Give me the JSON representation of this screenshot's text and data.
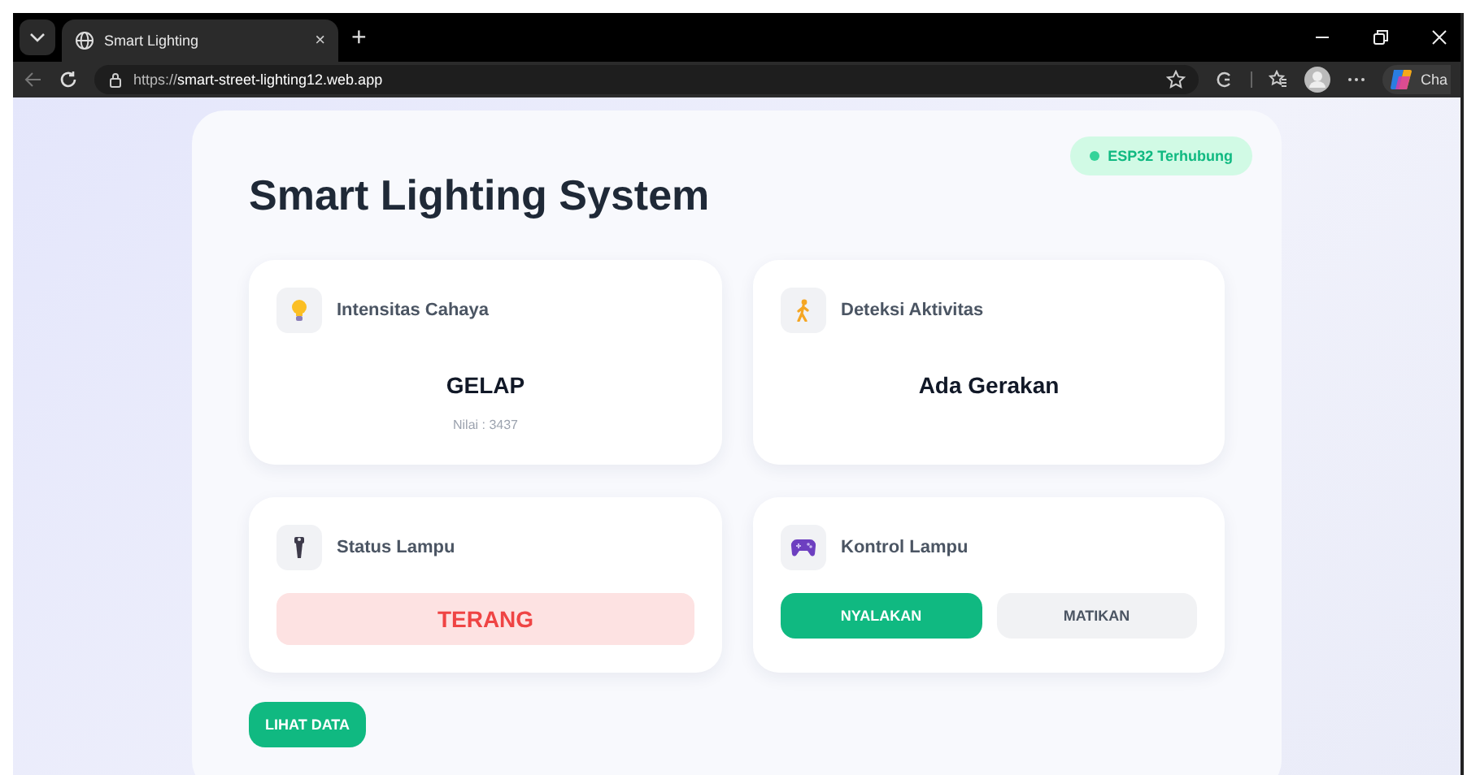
{
  "browser": {
    "tab_title": "Smart Lighting",
    "tab_close": "×",
    "new_tab": "+",
    "url_scheme": "https://",
    "url_host": "smart-street-lighting12.web.app",
    "copilot_label": "Cha"
  },
  "page": {
    "title": "Smart Lighting System",
    "connection": {
      "label": "ESP32 Terhubung",
      "color": "#34d399"
    },
    "cards": [
      {
        "kind": "reading",
        "label": "Intensitas Cahaya",
        "value": "GELAP",
        "note": "Nilai : 3437"
      },
      {
        "kind": "activity",
        "label": "Deteksi Aktivitas",
        "value": "Ada Gerakan"
      },
      {
        "kind": "status",
        "label": "Status Lampu",
        "value": "TERANG"
      },
      {
        "kind": "control",
        "label": "Kontrol Lampu",
        "buttons": [
          {
            "label": "NYALAKAN",
            "selected": true
          },
          {
            "label": "MATIKAN",
            "selected": false
          }
        ]
      }
    ],
    "action": "LIHAT DATA"
  }
}
